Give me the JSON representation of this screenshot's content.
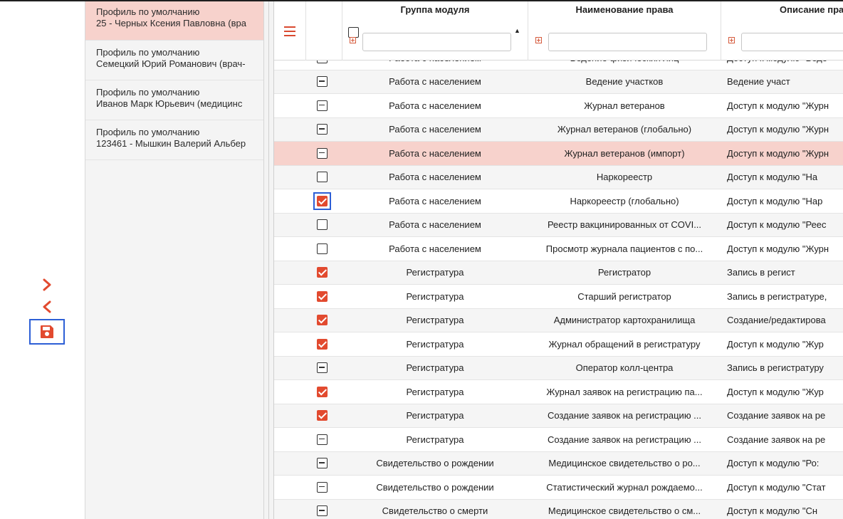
{
  "rail": {
    "next_icon": "chevron-right-icon",
    "prev_icon": "chevron-left-icon",
    "save_icon": "floppy-disk-icon",
    "accent": "#e24a2f",
    "focus_color": "#2d5fd6"
  },
  "profiles": [
    {
      "title": "Профиль по умолчанию",
      "name": "25 - Черных Ксения Павловна (вра",
      "selected": true
    },
    {
      "title": "Профиль по умолчанию",
      "name": "Семецкий Юрий Романович (врач-",
      "selected": false
    },
    {
      "title": "Профиль по умолчанию",
      "name": "Иванов Марк Юрьевич (медицинс",
      "selected": false
    },
    {
      "title": "Профиль по умолчанию",
      "name": "123461 - Мышкин Валерий Альбер",
      "selected": false
    }
  ],
  "grid": {
    "menu_icon": "hamburger-menu-icon",
    "columns": {
      "group": "Группа модуля",
      "name": "Наименование права",
      "desc": "Описание пра"
    },
    "filters": {
      "group": "",
      "name": "",
      "desc": ""
    },
    "rows": [
      {
        "state": "ind",
        "group": "Работа с населением",
        "name": "Ведение физических лиц",
        "desc": "Доступ к модулю \"Веде"
      },
      {
        "state": "ind",
        "group": "Работа с населением",
        "name": "Ведение участков",
        "desc": "Ведение участ"
      },
      {
        "state": "ind",
        "group": "Работа с населением",
        "name": "Журнал ветеранов",
        "desc": "Доступ к модулю \"Журн"
      },
      {
        "state": "ind",
        "group": "Работа с населением",
        "name": "Журнал ветеранов (глобально)",
        "desc": "Доступ к модулю \"Журн"
      },
      {
        "state": "ind",
        "group": "Работа с населением",
        "name": "Журнал ветеранов (импорт)",
        "desc": "Доступ к модулю \"Журн",
        "highlight": true
      },
      {
        "state": "off",
        "group": "Работа с населением",
        "name": "Наркореестр",
        "desc": "Доступ к модулю \"На"
      },
      {
        "state": "chk",
        "group": "Работа с населением",
        "name": "Наркореестр (глобально)",
        "desc": "Доступ к модулю \"Нар",
        "focused": true
      },
      {
        "state": "off",
        "group": "Работа с населением",
        "name": "Реестр вакцинированных от COVI...",
        "desc": "Доступ к модулю \"Реес"
      },
      {
        "state": "off",
        "group": "Работа с населением",
        "name": "Просмотр журнала пациентов с по...",
        "desc": "Доступ к модулю \"Журн"
      },
      {
        "state": "chk",
        "group": "Регистратура",
        "name": "Регистратор",
        "desc": "Запись в регист"
      },
      {
        "state": "chk",
        "group": "Регистратура",
        "name": "Старший регистратор",
        "desc": "Запись в регистратуре,"
      },
      {
        "state": "chk",
        "group": "Регистратура",
        "name": "Администратор картохранилища",
        "desc": "Создание/редактирова"
      },
      {
        "state": "chk",
        "group": "Регистратура",
        "name": "Журнал обращений в регистратуру",
        "desc": "Доступ к модулю \"Жур"
      },
      {
        "state": "ind",
        "group": "Регистратура",
        "name": "Оператор колл-центра",
        "desc": "Запись в регистратуру"
      },
      {
        "state": "chk",
        "group": "Регистратура",
        "name": "Журнал заявок на регистрацию па...",
        "desc": "Доступ к модулю \"Жур"
      },
      {
        "state": "chk",
        "group": "Регистратура",
        "name": "Создание заявок на регистрацию ...",
        "desc": "Создание заявок на ре"
      },
      {
        "state": "ind",
        "group": "Регистратура",
        "name": "Создание заявок на регистрацию ...",
        "desc": "Создание заявок на ре"
      },
      {
        "state": "ind",
        "group": "Свидетельство о рождении",
        "name": "Медицинское свидетельство о ро...",
        "desc": "Доступ к модулю \"Ро:"
      },
      {
        "state": "ind",
        "group": "Свидетельство о рождении",
        "name": "Статистический журнал рождаемо...",
        "desc": "Доступ к модулю \"Стат"
      },
      {
        "state": "ind",
        "group": "Свидетельство о смерти",
        "name": "Медицинское свидетельство о см...",
        "desc": "Доступ к модулю \"Сн"
      }
    ]
  }
}
